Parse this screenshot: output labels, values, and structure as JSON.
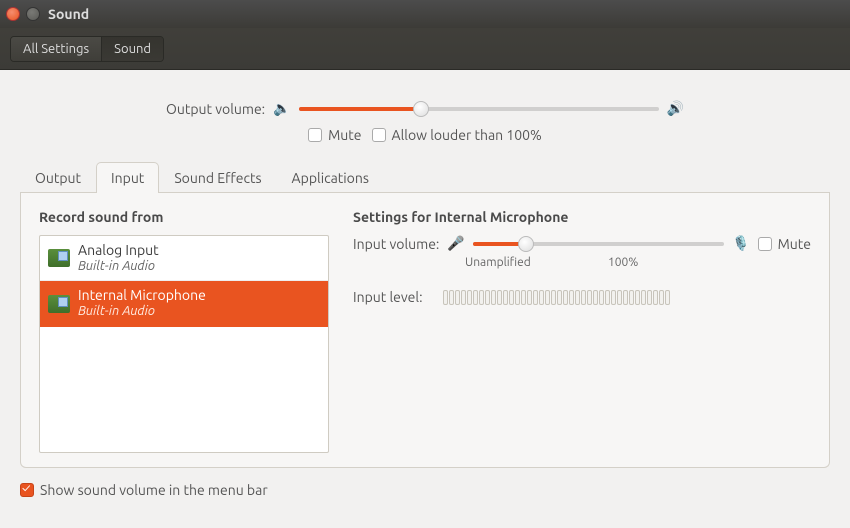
{
  "window": {
    "title": "Sound"
  },
  "breadcrumb": {
    "all_settings": "All Settings",
    "current": "Sound"
  },
  "output": {
    "label": "Output volume:",
    "fill_percent": 34,
    "mute_label": "Mute",
    "mute_checked": false,
    "allow_louder_label": "Allow louder than 100%",
    "allow_louder_checked": false
  },
  "tabs": {
    "output": "Output",
    "input": "Input",
    "sound_effects": "Sound Effects",
    "applications": "Applications",
    "active": "input"
  },
  "input_tab": {
    "record_heading": "Record sound from",
    "devices": [
      {
        "title": "Analog Input",
        "subtitle": "Built-in Audio",
        "selected": false
      },
      {
        "title": "Internal Microphone",
        "subtitle": "Built-in Audio",
        "selected": true
      }
    ],
    "settings_heading": "Settings for Internal Microphone",
    "input_volume_label": "Input volume:",
    "input_fill_percent": 21,
    "mute_label": "Mute",
    "mute_checked": false,
    "scale_unamplified": "Unamplified",
    "scale_100": "100%",
    "input_level_label": "Input level:",
    "level_segments": 38
  },
  "footer": {
    "show_in_menubar_label": "Show sound volume in the menu bar",
    "show_in_menubar_checked": true
  }
}
